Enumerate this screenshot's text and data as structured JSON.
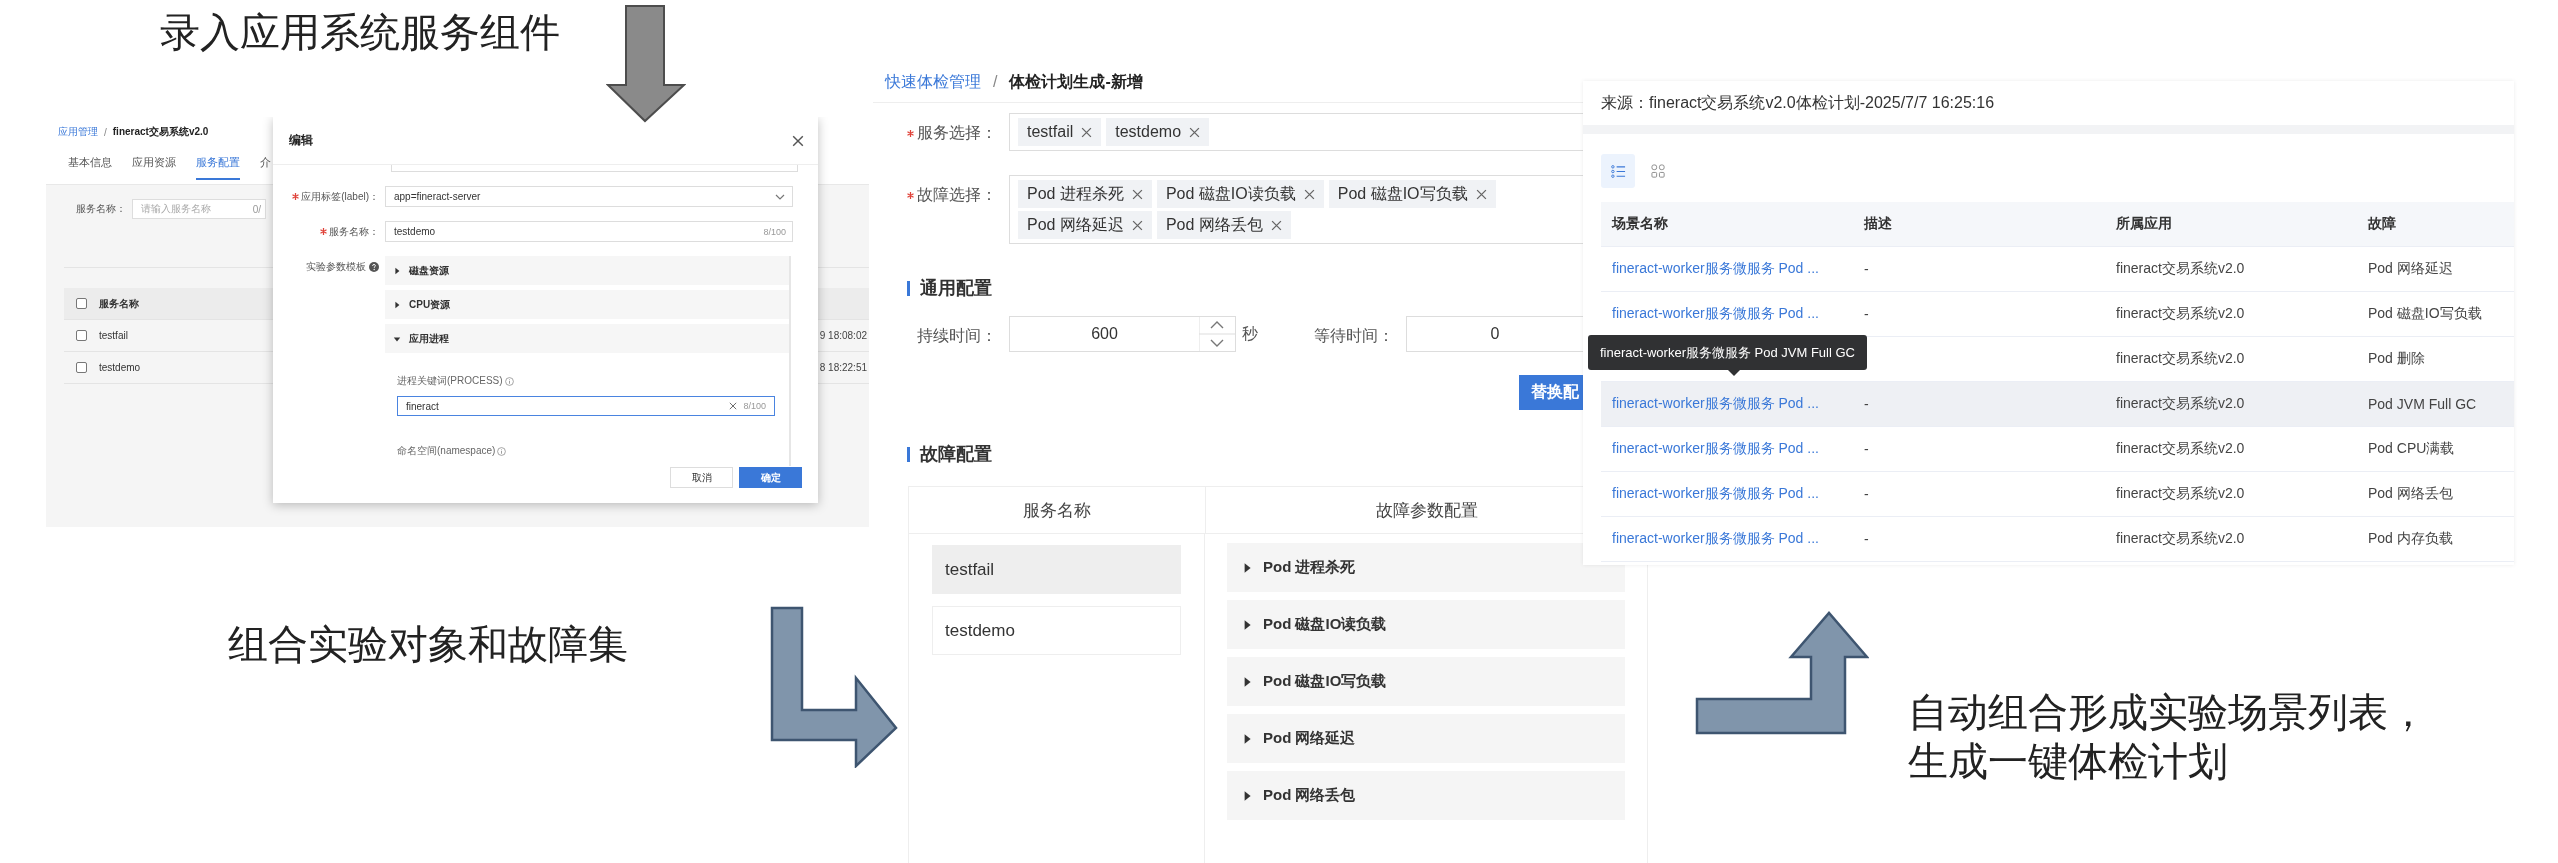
{
  "captions": [
    {
      "text": "录入应用系统服务组件"
    },
    {
      "text": "组合实验对象和故障集"
    },
    {
      "lines": [
        "自动组合形成实验场景列表，",
        "生成一键体检计划"
      ]
    }
  ],
  "app_screen": {
    "breadcrumb": {
      "parent": "应用管理",
      "separator": "/",
      "current": "fineract交易系统v2.0"
    },
    "tabs": [
      {
        "label": "基本信息",
        "selected": false
      },
      {
        "label": "应用资源",
        "selected": false
      },
      {
        "label": "服务配置",
        "selected": true
      },
      {
        "label": "介",
        "selected": false
      }
    ],
    "search": {
      "label": "服务名称：",
      "placeholder": "请输入服务名称",
      "count": "0/"
    },
    "table": {
      "header_checked": false,
      "columns": [
        "服务名称"
      ],
      "rows": [
        {
          "name": "testfail",
          "time": "9 18:08:02",
          "checked": false
        },
        {
          "name": "testdemo",
          "time": "8 18:22:51",
          "checked": false
        }
      ]
    },
    "dialog": {
      "title": "编辑",
      "fields": [
        {
          "kind": "select",
          "label": "应用标签(label)：",
          "required": true,
          "value": "app=fineract-server"
        },
        {
          "kind": "text",
          "label": "服务名称：",
          "required": true,
          "value": "testdemo",
          "count": "8/100"
        }
      ],
      "template_label": "实验参数模板",
      "panels": [
        {
          "title": "磁盘资源",
          "expanded": false
        },
        {
          "title": "CPU资源",
          "expanded": false
        },
        {
          "title": "应用进程",
          "expanded": true,
          "params": [
            {
              "label": "进程关键词(PROCESS)",
              "value": "fineract",
              "count": "8/100",
              "focused": true
            },
            {
              "label": "命名空间(namespace)"
            }
          ]
        }
      ],
      "buttons": [
        {
          "label": "取消",
          "kind": "default"
        },
        {
          "label": "确定",
          "kind": "primary"
        }
      ]
    }
  },
  "plan_screen": {
    "breadcrumb": {
      "parent": "快速体检管理",
      "separator": "/",
      "current": "体检计划生成-新增"
    },
    "selects": [
      {
        "label": "服务选择：",
        "required": true,
        "tags": [
          "testfail",
          "testdemo"
        ]
      },
      {
        "label": "故障选择：",
        "required": true,
        "tags": [
          "Pod 进程杀死",
          "Pod 磁盘IO读负载",
          "Pod 磁盘IO写负载",
          "Pod 网络延迟",
          "Pod 网络丢包"
        ]
      }
    ],
    "general": {
      "title": "通用配置",
      "duration": {
        "label": "持续时间：",
        "value": "600",
        "unit": "秒"
      },
      "wait": {
        "label": "等待时间：",
        "value": "0"
      },
      "button": "替换配"
    },
    "fault_config": {
      "title": "故障配置",
      "columns": [
        "服务名称",
        "故障参数配置"
      ],
      "services": [
        {
          "name": "testfail",
          "selected": true
        },
        {
          "name": "testdemo",
          "selected": false
        }
      ],
      "faults": [
        {
          "title": "Pod 进程杀死",
          "expanded": false
        },
        {
          "title": "Pod 磁盘IO读负载",
          "expanded": false
        },
        {
          "title": "Pod 磁盘IO写负载",
          "expanded": false
        },
        {
          "title": "Pod 网络延迟",
          "expanded": false
        },
        {
          "title": "Pod 网络丢包",
          "expanded": false
        }
      ]
    }
  },
  "scenario_screen": {
    "source": "来源：fineract交易系统v2.0体检计划-2025/7/7 16:25:16",
    "views": [
      {
        "kind": "list",
        "selected": true
      },
      {
        "kind": "grid",
        "selected": false
      }
    ],
    "columns": [
      "场景名称",
      "描述",
      "所属应用",
      "故障"
    ],
    "rows": [
      {
        "name": "fineract-worker服务微服务 Pod ...",
        "description": "-",
        "app": "fineract交易系统v2.0",
        "fault": "Pod 网络延迟",
        "hovered": false
      },
      {
        "name": "fineract-worker服务微服务 Pod ...",
        "description": "-",
        "app": "fineract交易系统v2.0",
        "fault": "Pod 磁盘IO写负载",
        "hovered": false
      },
      {
        "app": "fineract交易系统v2.0",
        "fault": "Pod 删除",
        "hovered": false
      },
      {
        "name": "fineract-worker服务微服务 Pod ...",
        "description": "-",
        "app": "fineract交易系统v2.0",
        "fault": "Pod JVM Full GC",
        "hovered": true
      },
      {
        "name": "fineract-worker服务微服务 Pod ...",
        "description": "-",
        "app": "fineract交易系统v2.0",
        "fault": "Pod CPU满载",
        "hovered": false
      },
      {
        "name": "fineract-worker服务微服务 Pod ...",
        "description": "-",
        "app": "fineract交易系统v2.0",
        "fault": "Pod 网络丢包",
        "hovered": false
      },
      {
        "name": "fineract-worker服务微服务 Pod ...",
        "description": "-",
        "app": "fineract交易系统v2.0",
        "fault": "Pod 内存负载",
        "hovered": false
      }
    ],
    "tooltip": "fineract-worker服务微服务 Pod JVM Full GC"
  }
}
